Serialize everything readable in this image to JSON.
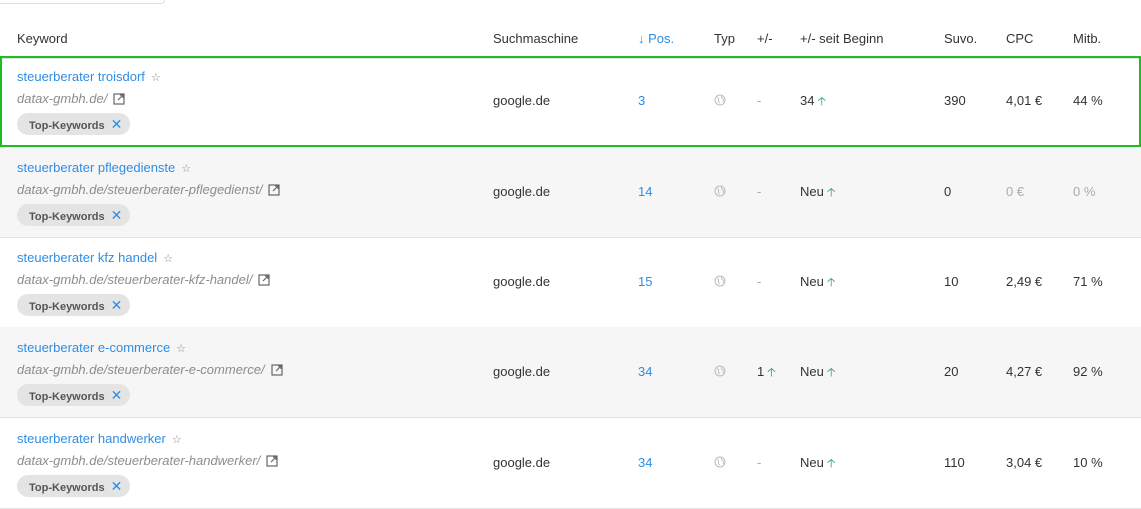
{
  "table": {
    "headers": {
      "keyword": "Keyword",
      "engine": "Suchmaschine",
      "pos": "↓ Pos.",
      "type": "Typ",
      "delta": "+/-",
      "since": "+/- seit Beginn",
      "volume": "Suvo.",
      "cpc": "CPC",
      "share": "Mitb."
    },
    "tag_label": "Top-Keywords",
    "rows": [
      {
        "keyword": "steuerberater troisdorf",
        "url": "datax-gmbh.de/",
        "engine": "google.de",
        "pos": "3",
        "delta": "-",
        "since": "34",
        "volume": "390",
        "cpc": "4,01 €",
        "share": "44 %"
      },
      {
        "keyword": "steuerberater pflegedienste",
        "url": "datax-gmbh.de/steuerberater-pflegedienst/",
        "engine": "google.de",
        "pos": "14",
        "delta": "-",
        "since": "Neu",
        "volume": "0",
        "cpc": "0 €",
        "share": "0 %"
      },
      {
        "keyword": "steuerberater kfz handel",
        "url": "datax-gmbh.de/steuerberater-kfz-handel/",
        "engine": "google.de",
        "pos": "15",
        "delta": "-",
        "since": "Neu",
        "volume": "10",
        "cpc": "2,49 €",
        "share": "71 %"
      },
      {
        "keyword": "steuerberater e-commerce",
        "url": "datax-gmbh.de/steuerberater-e-commerce/",
        "engine": "google.de",
        "pos": "34",
        "delta": "1",
        "since": "Neu",
        "volume": "20",
        "cpc": "4,27 €",
        "share": "92 %"
      },
      {
        "keyword": "steuerberater handwerker",
        "url": "datax-gmbh.de/steuerberater-handwerker/",
        "engine": "google.de",
        "pos": "34",
        "delta": "-",
        "since": "Neu",
        "volume": "110",
        "cpc": "3,04 €",
        "share": "10 %"
      }
    ]
  },
  "colors": {
    "accent": "#2f8de4",
    "up_arrow": "#2e9e5b",
    "highlight": "#1fbe1f"
  },
  "icons": {
    "star": "star-icon",
    "external": "external-link-icon",
    "type": "globe-icon",
    "remove": "close-icon",
    "trend": "arrow-up-icon"
  }
}
